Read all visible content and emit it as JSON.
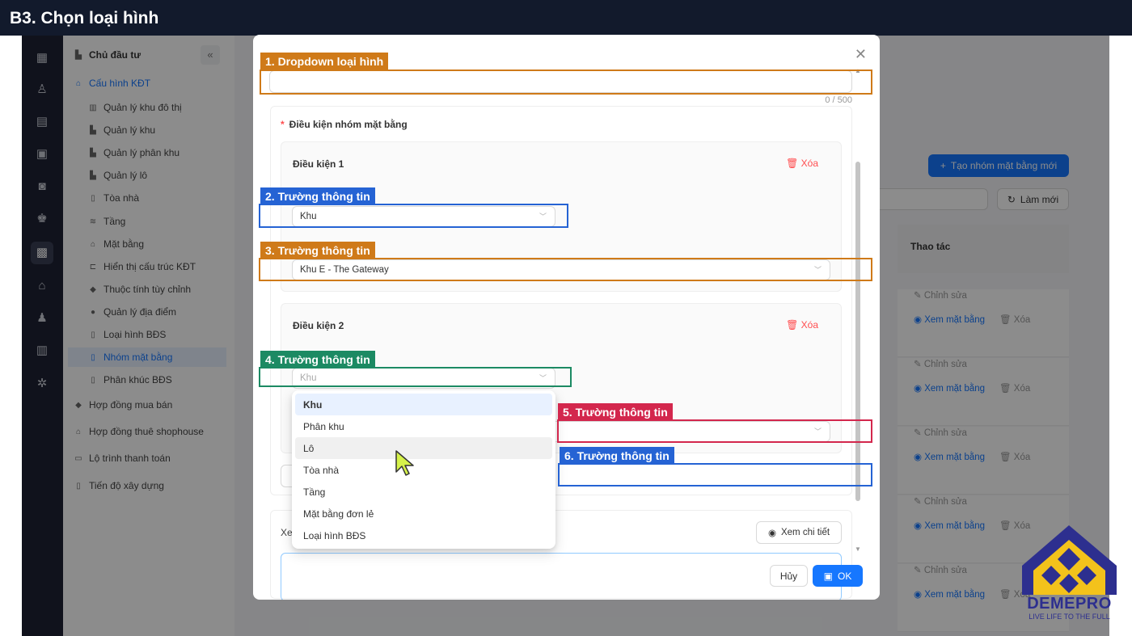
{
  "header": {
    "title": "B3. Chọn loại hình"
  },
  "rail_icons": [
    "building-icon",
    "sales-icon",
    "calculator-icon",
    "briefcase-icon",
    "car-icon",
    "users-icon",
    "building-active-icon",
    "store-icon",
    "person-icon",
    "chart-icon",
    "settings-icon"
  ],
  "sidebar": {
    "collapse_glyph": "«",
    "items": [
      {
        "label": "Chủ đầu tư"
      },
      {
        "label": "Cấu hình KĐT"
      },
      {
        "label": "Quản lý khu đô thị"
      },
      {
        "label": "Quản lý khu"
      },
      {
        "label": "Quản lý phân khu"
      },
      {
        "label": "Quản lý lô"
      },
      {
        "label": "Tòa nhà"
      },
      {
        "label": "Tầng"
      },
      {
        "label": "Mặt bằng"
      },
      {
        "label": "Hiển thị cấu trúc KĐT"
      },
      {
        "label": "Thuộc tính tùy chỉnh"
      },
      {
        "label": "Quản lý địa điểm"
      },
      {
        "label": "Loại hình BĐS"
      },
      {
        "label": "Nhóm mặt bằng"
      },
      {
        "label": "Phân khúc BĐS"
      },
      {
        "label": "Hợp đồng mua bán"
      },
      {
        "label": "Hợp đồng thuê shophouse"
      },
      {
        "label": "Lộ trình thanh toán"
      },
      {
        "label": "Tiến độ xây dựng"
      }
    ]
  },
  "main": {
    "new_group_button": "Tạo nhóm mặt bằng mới",
    "refresh_button": "Làm mới",
    "column_actions": "Thao tác",
    "row_actions": {
      "edit": "Chỉnh sửa",
      "view": "Xem mặt bằng",
      "delete": "Xóa"
    }
  },
  "modal": {
    "counter": "0 / 500",
    "condition_group_label": "Điều kiện nhóm mặt bằng",
    "conditions": [
      {
        "title": "Điều kiện 1",
        "delete_label": "Xóa",
        "type_value": "Khu",
        "target_value": "Khu E - The Gateway"
      },
      {
        "title": "Điều kiện 2",
        "delete_label": "Xóa",
        "type_placeholder": "Khu"
      }
    ],
    "dropdown_options": [
      "Khu",
      "Phân khu",
      "Lô",
      "Tòa nhà",
      "Tầng",
      "Mặt bằng đơn lẻ",
      "Loại hình BĐS"
    ],
    "preview_label": "Xe",
    "detail_button": "Xem chi tiết",
    "cancel_button": "Hủy",
    "ok_button": "OK"
  },
  "annotations": [
    {
      "label": "1. Dropdown loại hình",
      "color": "#cf7a19"
    },
    {
      "label": "2. Trường thông tin",
      "color": "#2563d4"
    },
    {
      "label": "3. Trường thông tin",
      "color": "#cf7a19"
    },
    {
      "label": "4. Trường thông tin",
      "color": "#1c8a63"
    },
    {
      "label": "5. Trường thông tin",
      "color": "#d3274d"
    },
    {
      "label": "6. Trường thông tin",
      "color": "#2563d4"
    }
  ],
  "logo": {
    "name": "DEMEPRO",
    "tagline": "LIVE LIFE TO THE FULL"
  }
}
